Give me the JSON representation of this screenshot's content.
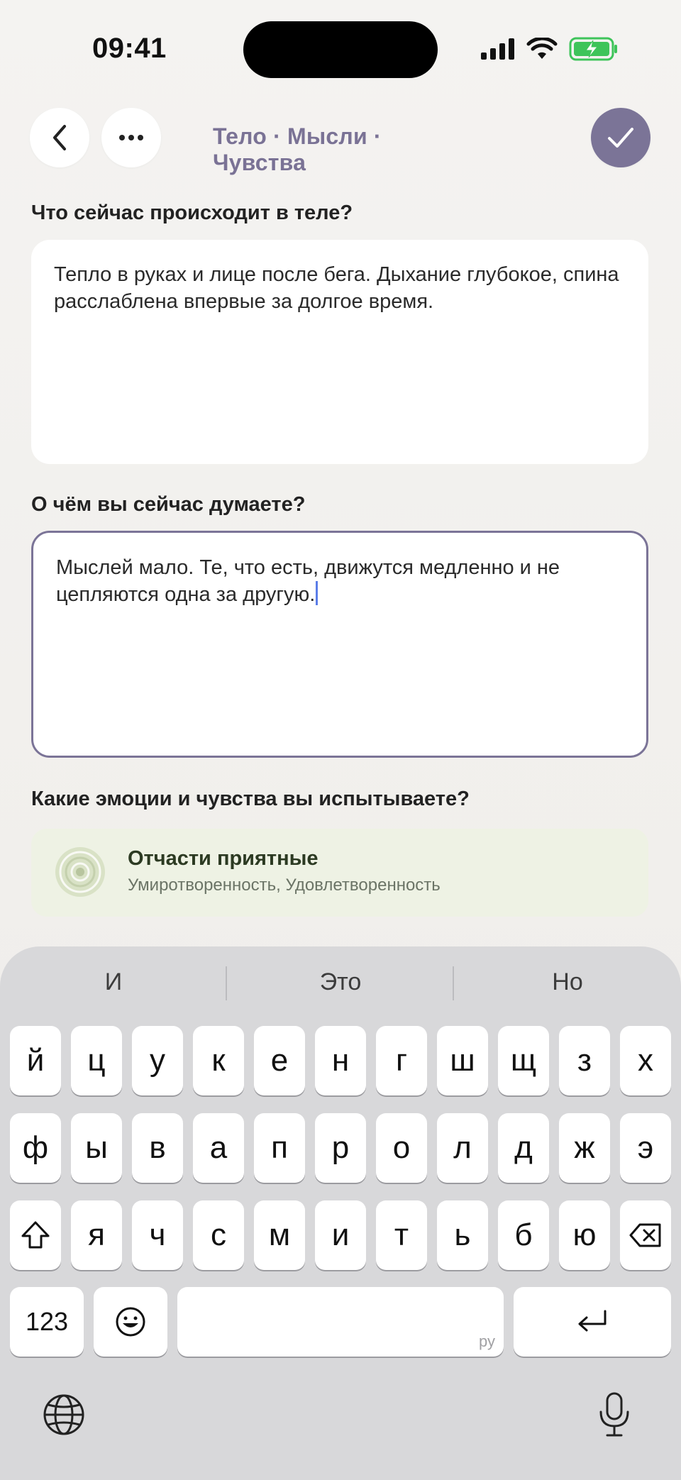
{
  "status": {
    "time": "09:41"
  },
  "nav": {
    "title": "Тело · Мысли · Чувства"
  },
  "body_section": {
    "question": "Что сейчас происходит в теле?",
    "answer": "Тепло в руках и лице после бега. Дыхание глубокое, спина расслаблена впервые за долгое время."
  },
  "thoughts_section": {
    "question": "О чём вы сейчас думаете?",
    "answer": "Мыслей мало. Те, что есть, движутся медленно и не цепляются одна за другую."
  },
  "emotions_section": {
    "question": "Какие эмоции и чувства вы испытываете?",
    "title": "Отчасти приятные",
    "subtitle": "Умиротворенность, Удовлетворенность"
  },
  "keyboard": {
    "suggestions": [
      "И",
      "Это",
      "Но"
    ],
    "row1": [
      "й",
      "ц",
      "у",
      "к",
      "е",
      "н",
      "г",
      "ш",
      "щ",
      "з",
      "х"
    ],
    "row2": [
      "ф",
      "ы",
      "в",
      "а",
      "п",
      "р",
      "о",
      "л",
      "д",
      "ж",
      "э"
    ],
    "row3": [
      "я",
      "ч",
      "с",
      "м",
      "и",
      "т",
      "ь",
      "б",
      "ю"
    ],
    "numbers_label": "123",
    "space_lang": "ру"
  }
}
